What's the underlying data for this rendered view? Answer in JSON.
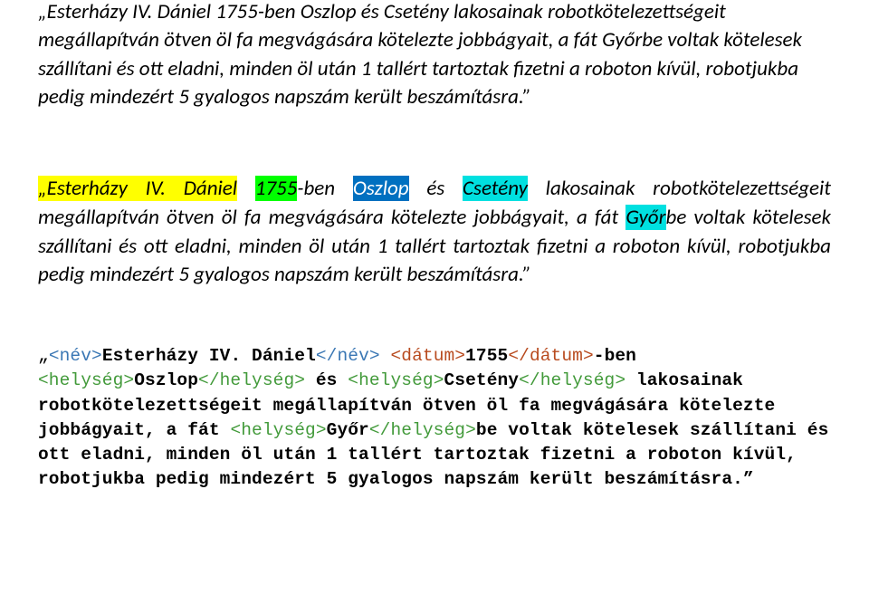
{
  "para1": {
    "text": "„Esterházy IV. Dániel 1755-ben Oszlop és Csetény lakosainak robotkötelezettségeit megállapítván ötven öl fa megvágására kötelezte jobbágyait, a fát Győrbe voltak kötelesek szállítani és ott eladni, minden öl után 1 tallért tartoztak fizetni a roboton kívül, robotjukba pedig mindezért 5 gyalogos napszám került beszámításra.”"
  },
  "para2": {
    "s1": "„Esterházy IV. ",
    "s2": "Dániel",
    "s3": " ",
    "s4": "1755",
    "s5": "-ben ",
    "s6": "Oszlop",
    "s7": " és ",
    "s8": "Csetény",
    "s9": " lakosainak robotkötelezettségeit megállapítván ötven öl fa megvágására kötelezte jobbágyait, a fát ",
    "s10": "Győr",
    "s11": "be voltak kötelesek szállítani és ott eladni, minden öl után 1 tallért tartoztak fizetni a roboton kívül, robotjukba pedig mindezért 5 gyalogos napszám került beszámításra.”"
  },
  "para3": {
    "q_open": "„",
    "nev_open": "<név>",
    "nev": "Esterházy IV. Dániel",
    "nev_close": "</név>",
    "sp": " ",
    "datum_open": "<dátum>",
    "datum": "1755",
    "datum_close": "</dátum>",
    "ben": "-ben ",
    "hely_open1": "<helység>",
    "hely1": "Oszlop",
    "hely_close1": "</helység>",
    "es": " és ",
    "hely_open2": "<helység>",
    "hely2": "Csetény",
    "hely_close2": "</helység>",
    "mid1": " lakosainak robotkötelezettségeit megállapítván ötven öl fa megvágására kötelezte jobbágyait, a fát ",
    "hely_open3": "<helység>",
    "hely3": "Győr",
    "hely_close3": "</helység>",
    "rest": "be voltak kötelesek szállítani és ott eladni, minden öl után 1 tallért tartoztak fizetni a roboton kívül, robotjukba pedig mindezért 5 gyalogos napszám került beszámításra.”"
  }
}
